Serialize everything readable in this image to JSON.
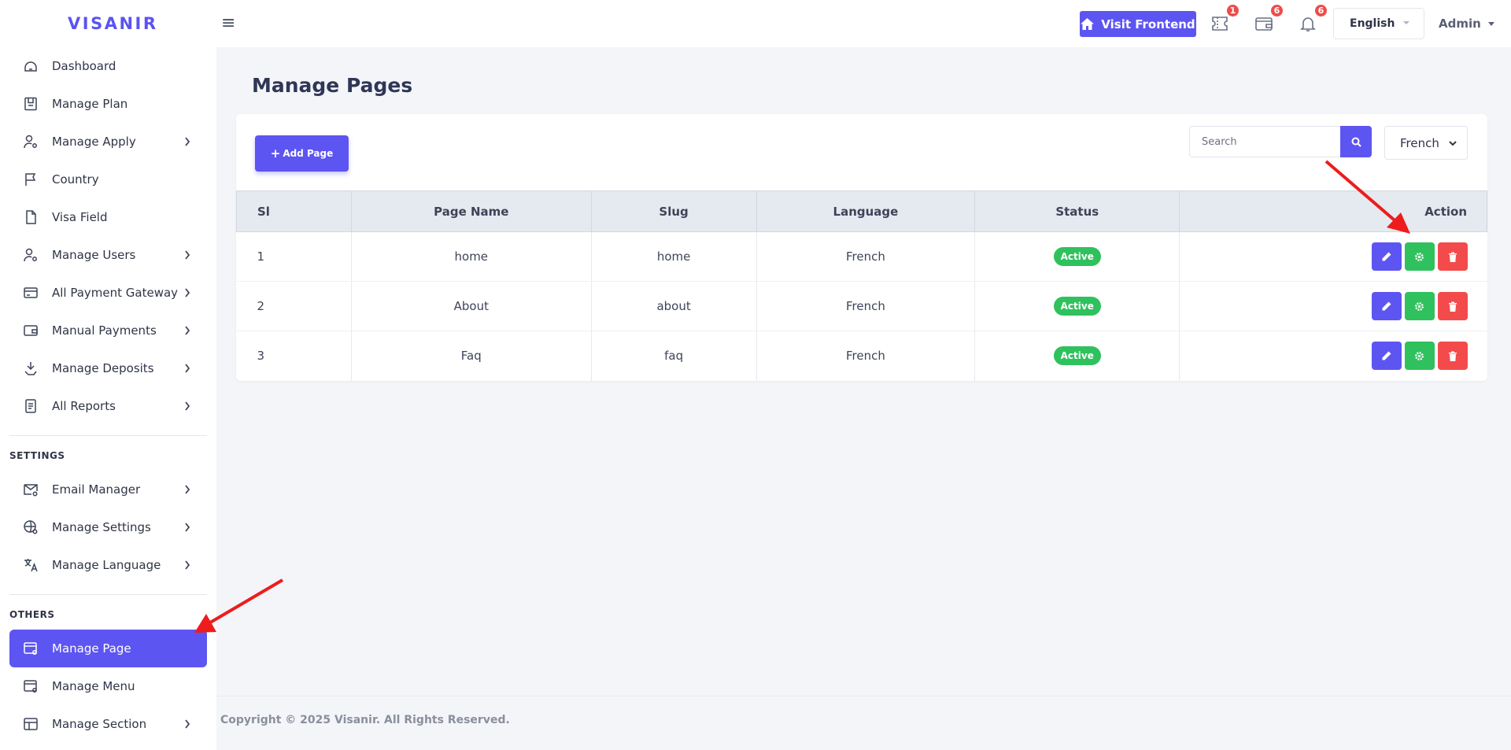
{
  "brand": "VISANIR",
  "topbar": {
    "menu_icon": "hamburger-icon",
    "visit_frontend": "Visit Frontend",
    "badges": {
      "tickets": "1",
      "wallet": "6",
      "notifications": "6"
    },
    "language": "English",
    "user": "Admin"
  },
  "sidebar": {
    "items": [
      {
        "label": "Dashboard",
        "icon": "dashboard-icon"
      },
      {
        "label": "Manage Plan",
        "icon": "plan-icon"
      },
      {
        "label": "Manage Apply",
        "icon": "user-gear-icon"
      },
      {
        "label": "Country",
        "icon": "flag-icon"
      },
      {
        "label": "Visa Field",
        "icon": "file-icon"
      },
      {
        "label": "Manage Users",
        "icon": "users-gear-icon"
      },
      {
        "label": "All Payment Gateway",
        "icon": "credit-card-icon"
      },
      {
        "label": "Manual Payments",
        "icon": "wallet-icon"
      },
      {
        "label": "Manage Deposits",
        "icon": "deposit-icon"
      },
      {
        "label": "All Reports",
        "icon": "report-icon"
      }
    ],
    "settings_title": "SETTINGS",
    "settings_items": [
      {
        "label": "Email Manager",
        "icon": "mail-gear-icon"
      },
      {
        "label": "Manage Settings",
        "icon": "globe-gear-icon"
      },
      {
        "label": "Manage Language",
        "icon": "translate-icon"
      }
    ],
    "others_title": "OTHERS",
    "others_items": [
      {
        "label": "Manage Page",
        "icon": "page-gear-icon"
      },
      {
        "label": "Manage Menu",
        "icon": "menu-gear-icon"
      },
      {
        "label": "Manage Section",
        "icon": "section-icon"
      }
    ]
  },
  "main": {
    "title": "Manage Pages",
    "add_button": "Add Page",
    "search_placeholder": "Search",
    "language_filter": "French",
    "columns": [
      "Sl",
      "Page Name",
      "Slug",
      "Language",
      "Status",
      "Action"
    ],
    "rows": [
      {
        "sl": "1",
        "name": "home",
        "slug": "home",
        "language": "French",
        "status": "Active"
      },
      {
        "sl": "2",
        "name": "About",
        "slug": "about",
        "language": "French",
        "status": "Active"
      },
      {
        "sl": "3",
        "name": "Faq",
        "slug": "faq",
        "language": "French",
        "status": "Active"
      }
    ]
  },
  "footer": {
    "copyright": "Copyright © 2025 Visanir. All Rights Reserved."
  },
  "colors": {
    "accent": "#5d55f1",
    "success": "#2fc15d",
    "danger": "#f34b4b",
    "annotation": "#ee1c1c"
  }
}
